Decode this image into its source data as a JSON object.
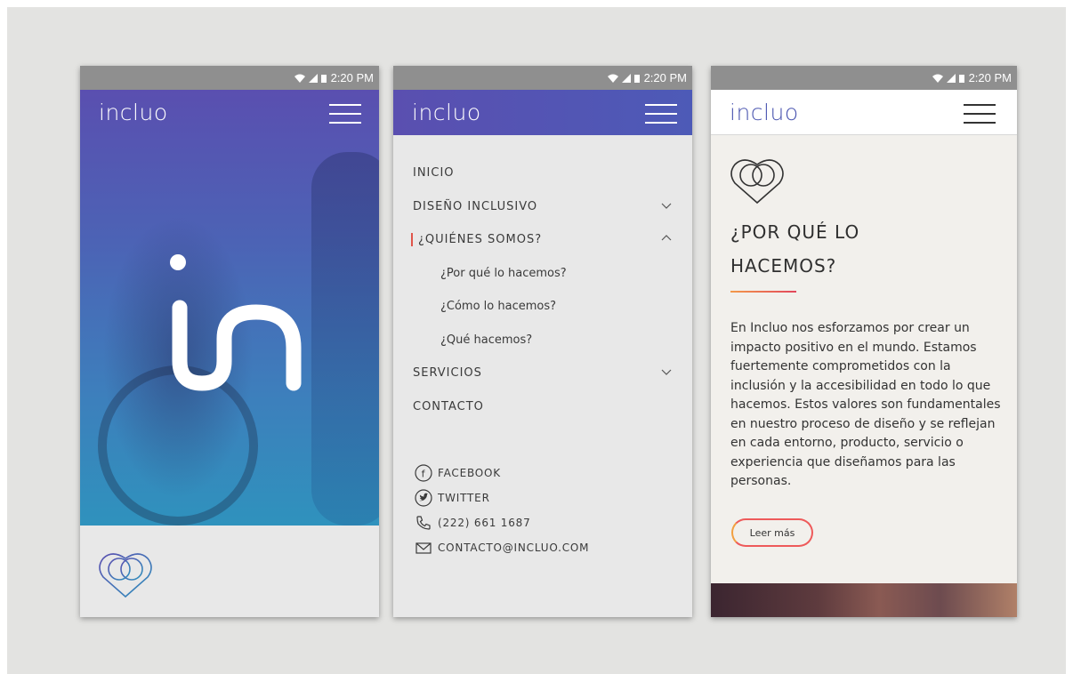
{
  "status": {
    "time": "2:20 PM"
  },
  "brand": {
    "logo": "incluo"
  },
  "screen1": {
    "hero_letters": "in"
  },
  "menu": {
    "items": [
      {
        "label": "INICIO"
      },
      {
        "label": "DISEÑO INCLUSIVO"
      },
      {
        "label": "¿QUIÉNES SOMOS?"
      },
      {
        "label": "SERVICIOS"
      },
      {
        "label": "CONTACTO"
      }
    ],
    "subitems": [
      {
        "label": "¿Por qué lo hacemos?"
      },
      {
        "label": "¿Cómo lo hacemos?"
      },
      {
        "label": "¿Qué hacemos?"
      }
    ]
  },
  "contact": {
    "facebook": "FACEBOOK",
    "twitter": "TWITTER",
    "phone": "(222) 661 1687",
    "email": "CONTACTO@INCLUO.COM"
  },
  "about": {
    "title_line1": "¿POR QUÉ LO",
    "title_line2": "HACEMOS?",
    "paragraph": "En Incluo nos esforzamos por crear un impacto positivo en el mundo. Estamos fuertemente comprometidos con la inclusión y la accesibilidad en todo lo que hacemos. Estos valores son fundamentales en nuestro proceso de diseño y se reflejan en cada entorno, producto, servicio o experiencia que diseñamos para las personas.",
    "read_more": "Leer más"
  },
  "colors": {
    "brand_purple": "#5a4fb0",
    "brand_teal": "#2f92bd",
    "accent_orange": "#f39a4a",
    "accent_red": "#e0544a"
  },
  "icons": [
    "wifi-icon",
    "signal-icon",
    "battery-icon",
    "menu-icon",
    "chevron-down-icon",
    "chevron-up-icon",
    "facebook-icon",
    "twitter-icon",
    "phone-icon",
    "mail-icon",
    "heart-rings-icon"
  ]
}
